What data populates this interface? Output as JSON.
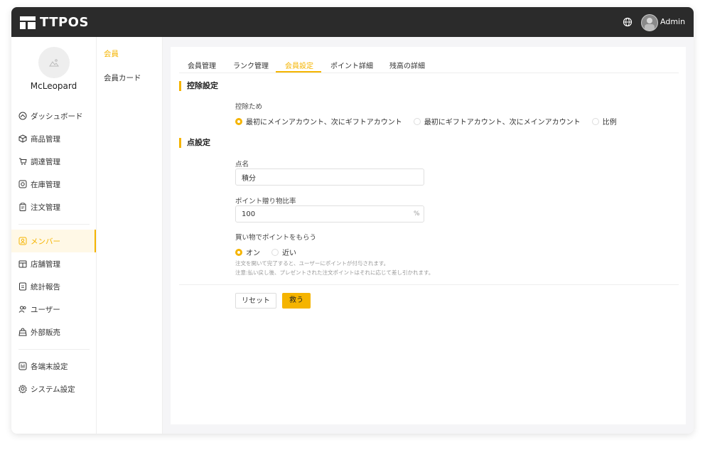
{
  "app": {
    "logo_text": "TTPOS",
    "user": "Admin"
  },
  "profile": {
    "name": "McLeopard"
  },
  "sidebar": {
    "items": [
      {
        "label": "ダッシュボード",
        "icon": "dashboard-icon"
      },
      {
        "label": "商品管理",
        "icon": "box-icon"
      },
      {
        "label": "調達管理",
        "icon": "cart-icon"
      },
      {
        "label": "在庫管理",
        "icon": "inventory-icon"
      },
      {
        "label": "注文管理",
        "icon": "clipboard-icon"
      },
      {
        "label": "メンバー",
        "icon": "member-icon",
        "active": true
      },
      {
        "label": "店舗管理",
        "icon": "store-icon"
      },
      {
        "label": "統計報告",
        "icon": "report-icon"
      },
      {
        "label": "ユーザー",
        "icon": "users-icon"
      },
      {
        "label": "外部販売",
        "icon": "bag-icon"
      },
      {
        "label": "各端末設定",
        "icon": "terminal-icon"
      },
      {
        "label": "システム設定",
        "icon": "gear-icon"
      }
    ]
  },
  "subnav": {
    "items": [
      {
        "label": "会員",
        "active": true
      },
      {
        "label": "会員カード"
      }
    ]
  },
  "tabs": [
    {
      "label": "会員管理"
    },
    {
      "label": "ランク管理"
    },
    {
      "label": "会員設定",
      "active": true
    },
    {
      "label": "ポイント詳細"
    },
    {
      "label": "残高の詳細"
    }
  ],
  "deduction": {
    "section_title": "控除設定",
    "label": "控除ため",
    "options": [
      {
        "label": "最初にメインアカウント、次にギフトアカウント",
        "selected": true
      },
      {
        "label": "最初にギフトアカウント、次にメインアカウント",
        "selected": false
      },
      {
        "label": "比例",
        "selected": false
      }
    ]
  },
  "points": {
    "section_title": "点設定",
    "name_label": "点名",
    "name_value": "積分",
    "ratio_label": "ポイント贈り物比率",
    "ratio_value": "100",
    "ratio_unit": "%",
    "shopping_label": "買い物でポイントをもらう",
    "shopping_options": [
      {
        "label": "オン",
        "selected": true
      },
      {
        "label": "近い",
        "selected": false
      }
    ],
    "note1": "注文を開いて完了すると、ユーザーにポイントが付与されます。",
    "note2": "注意:払い戻し後、プレゼントされた注文ポイントはそれに応じて差し引かれます。"
  },
  "buttons": {
    "reset": "リセット",
    "save": "救う"
  },
  "colors": {
    "accent": "#f5b400",
    "topbar": "#2b2b2b"
  }
}
